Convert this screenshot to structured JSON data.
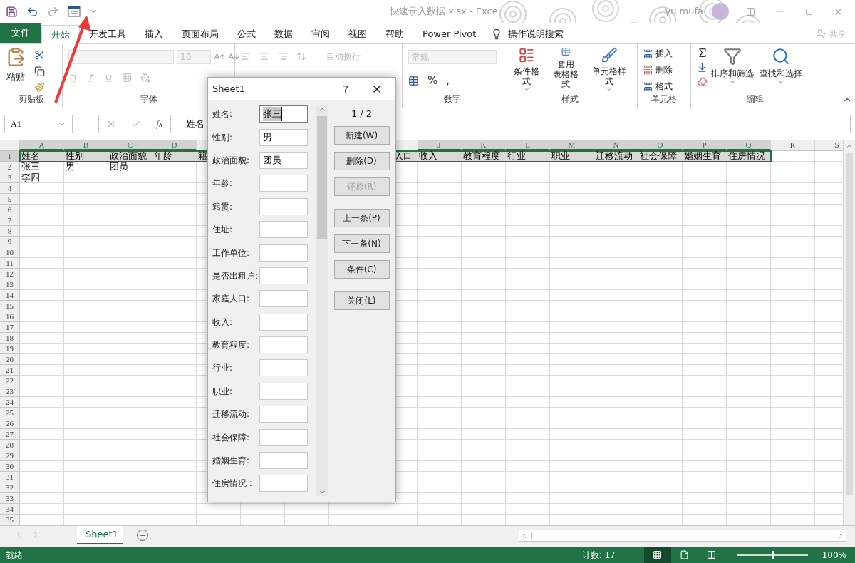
{
  "title_bar": {
    "title": "快速录入数据.xlsx  -  Excel",
    "user": "yu mufa",
    "share": "共享"
  },
  "menu_tabs": [
    {
      "label": "文件",
      "kind": "file",
      "selected": false
    },
    {
      "label": "开始",
      "kind": "tab",
      "selected": true
    },
    {
      "label": "开发工具",
      "kind": "tab",
      "selected": false
    },
    {
      "label": "插入",
      "kind": "tab",
      "selected": false
    },
    {
      "label": "页面布局",
      "kind": "tab",
      "selected": false
    },
    {
      "label": "公式",
      "kind": "tab",
      "selected": false
    },
    {
      "label": "数据",
      "kind": "tab",
      "selected": false
    },
    {
      "label": "审阅",
      "kind": "tab",
      "selected": false
    },
    {
      "label": "视图",
      "kind": "tab",
      "selected": false
    },
    {
      "label": "帮助",
      "kind": "tab",
      "selected": false
    },
    {
      "label": "Power Pivot",
      "kind": "tab",
      "selected": false
    },
    {
      "label": "操作说明搜索",
      "kind": "search",
      "selected": false
    }
  ],
  "ribbon": {
    "clipboard": {
      "paste": "粘贴",
      "label": "剪贴板"
    },
    "font": {
      "size": "10",
      "label": "字体"
    },
    "alignment": {
      "wrap": "自动换行"
    },
    "number": {
      "format": "常规",
      "percent": "%",
      "comma": ",",
      "label": "数字"
    },
    "styles": {
      "items": [
        {
          "lines": [
            "条件格式"
          ]
        },
        {
          "lines": [
            "套用",
            "表格格式"
          ]
        },
        {
          "lines": [
            "单元格样式"
          ]
        }
      ],
      "label": "样式"
    },
    "cells": {
      "items": [
        "插入",
        "删除",
        "格式"
      ],
      "label": "单元格"
    },
    "editing": {
      "items": [
        "排序和筛选",
        "查找和选择"
      ],
      "label": "编辑"
    }
  },
  "formula_bar": {
    "name_box": "A1",
    "fx": "fx",
    "formula": "姓名"
  },
  "columns": [
    {
      "letter": "A",
      "selected": true
    },
    {
      "letter": "B",
      "selected": true
    },
    {
      "letter": "C",
      "selected": true
    },
    {
      "letter": "D",
      "selected": true
    },
    {
      "kind": "covered"
    },
    {
      "kind": "covered"
    },
    {
      "kind": "covered"
    },
    {
      "kind": "covered"
    },
    {
      "kind": "covered"
    },
    {
      "letter": "J",
      "selected": true
    },
    {
      "letter": "K",
      "selected": true
    },
    {
      "letter": "L",
      "selected": true
    },
    {
      "letter": "M",
      "selected": true
    },
    {
      "letter": "N",
      "selected": true
    },
    {
      "letter": "O",
      "selected": true
    },
    {
      "letter": "P",
      "selected": true
    },
    {
      "letter": "Q",
      "selected": true
    },
    {
      "letter": "R",
      "selected": false
    },
    {
      "letter": "S",
      "selected": false
    }
  ],
  "rows": [
    {
      "number": "1",
      "selected": true,
      "cells": [
        "姓名",
        "性别",
        "政治面貌",
        "年龄",
        "籍",
        null,
        null,
        null,
        "入口",
        "收入",
        "教育程度",
        "行业",
        "职业",
        "迁移流动",
        "社会保障",
        "婚姻生育",
        "住房情况"
      ]
    },
    {
      "number": "2",
      "selected": false,
      "cells": [
        "张三",
        "男",
        "团员"
      ]
    },
    {
      "number": "3",
      "selected": false,
      "cells": [
        "李四"
      ]
    },
    {
      "number": "4",
      "selected": false
    },
    {
      "number": "5",
      "selected": false
    },
    {
      "number": "6",
      "selected": false
    },
    {
      "number": "7",
      "selected": false
    },
    {
      "number": "8",
      "selected": false
    },
    {
      "number": "9",
      "selected": false
    },
    {
      "number": "10",
      "selected": false
    },
    {
      "number": "11",
      "selected": false
    },
    {
      "number": "12",
      "selected": false
    },
    {
      "number": "13",
      "selected": false
    },
    {
      "number": "14",
      "selected": false
    },
    {
      "number": "15",
      "selected": false
    },
    {
      "number": "16",
      "selected": false
    },
    {
      "number": "17",
      "selected": false
    },
    {
      "number": "18",
      "selected": false
    },
    {
      "number": "19",
      "selected": false
    },
    {
      "number": "20",
      "selected": false
    },
    {
      "number": "21",
      "selected": false
    },
    {
      "number": "22",
      "selected": false
    },
    {
      "number": "23",
      "selected": false
    },
    {
      "number": "24",
      "selected": false
    },
    {
      "number": "25",
      "selected": false
    },
    {
      "number": "26",
      "selected": false
    },
    {
      "number": "27",
      "selected": false
    },
    {
      "number": "28",
      "selected": false
    },
    {
      "number": "29",
      "selected": false
    },
    {
      "number": "30",
      "selected": false
    },
    {
      "number": "31",
      "selected": false
    },
    {
      "number": "32",
      "selected": false
    },
    {
      "number": "33",
      "selected": false
    },
    {
      "number": "34",
      "selected": false
    },
    {
      "number": "35",
      "selected": false
    }
  ],
  "dialog": {
    "title": "Sheet1",
    "help": "?",
    "counter": "1 / 2",
    "fields": [
      {
        "label": "姓名:",
        "value": "张三",
        "focused": true
      },
      {
        "label": "性别:",
        "value": "男",
        "focused": false
      },
      {
        "label": "政治面貌:",
        "value": "团员",
        "focused": false
      },
      {
        "label": "年龄:",
        "focused": false
      },
      {
        "label": "籍贯:",
        "focused": false
      },
      {
        "label": "住址:",
        "focused": false
      },
      {
        "label": "工作单位:",
        "focused": false
      },
      {
        "label": "是否出租户:",
        "focused": false
      },
      {
        "label": "家庭人口:",
        "focused": false
      },
      {
        "label": "收入:",
        "focused": false
      },
      {
        "label": "教育程度:",
        "focused": false
      },
      {
        "label": "行业:",
        "focused": false
      },
      {
        "label": "职业:",
        "focused": false
      },
      {
        "label": "迁移流动:",
        "focused": false
      },
      {
        "label": "社会保障:",
        "focused": false
      },
      {
        "label": "婚姻生育:",
        "focused": false
      },
      {
        "label": "住房情况 :",
        "focused": false
      }
    ],
    "button_groups": [
      [
        {
          "label": "新建(W)",
          "disabled": false
        },
        {
          "label": "删除(D)",
          "disabled": false
        },
        {
          "label": "还原(R)",
          "disabled": true
        }
      ],
      [
        {
          "label": "上一条(P)",
          "disabled": false
        },
        {
          "label": "下一条(N)",
          "disabled": false
        },
        {
          "label": "条件(C)",
          "disabled": false
        }
      ],
      [
        {
          "label": "关闭(L)",
          "disabled": false
        }
      ]
    ]
  },
  "sheet_tabs": [
    {
      "label": "Sheet1",
      "selected": true
    }
  ],
  "status_bar": {
    "ready": "就绪",
    "count": "计数: 17",
    "zoom": "100%",
    "zoom_slider": {
      "level": 0.5
    },
    "views": [
      {
        "kind": "normal",
        "selected": true
      },
      {
        "kind": "page",
        "selected": false
      },
      {
        "kind": "break",
        "selected": false
      }
    ]
  }
}
